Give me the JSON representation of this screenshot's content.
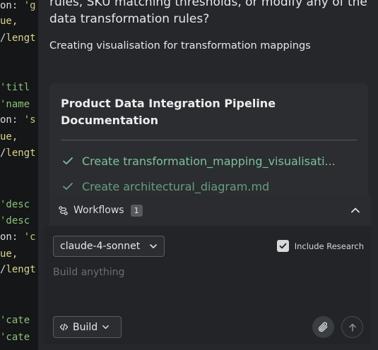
{
  "code_strip": {
    "lines": [
      {
        "a": "on: ",
        "b": "'g"
      },
      {
        "a": "ue,",
        "b": ""
      },
      {
        "a": "lengt",
        "b": ""
      },
      {
        "a": "'titl",
        "b": ""
      },
      {
        "a": "'name",
        "b": ""
      },
      {
        "a": "on: ",
        "b": "'s"
      },
      {
        "a": "ue,",
        "b": ""
      },
      {
        "a": "lengt",
        "b": ""
      },
      {
        "a": "'desc",
        "b": ""
      },
      {
        "a": "'desc",
        "b": ""
      },
      {
        "a": "on: ",
        "b": "'c"
      },
      {
        "a": "ue,",
        "b": ""
      },
      {
        "a": "lengt",
        "b": ""
      },
      {
        "a": "'cate",
        "b": ""
      },
      {
        "a": "'cate",
        "b": ""
      }
    ]
  },
  "chat": {
    "assistant_message_line1": "rules, SKU matching thresholds, or modify any of the",
    "assistant_message_line2": "data transformation rules?",
    "status": "Creating visualisation for transformation mappings"
  },
  "task_card": {
    "title": "Product Data Integration Pipeline Documentation",
    "items": [
      {
        "label": "Create transformation_mapping_visualisati..."
      },
      {
        "label": "Create architectural_diagram.md"
      }
    ]
  },
  "workflows": {
    "label": "Workflows",
    "count": "1"
  },
  "composer": {
    "model": "claude-4-sonnet",
    "include_research_label": "Include Research",
    "include_research_checked": true,
    "placeholder": "Build anything",
    "value": "",
    "mode_label": "Build"
  },
  "icons": {
    "workflow": "workflow-icon",
    "collapse": "chevron-up-icon",
    "check": "check-icon",
    "attach": "paperclip-icon",
    "send": "arrow-up-icon",
    "code": "code-icon"
  },
  "colors": {
    "accent_green": "#7cc29a",
    "panel": "#25272a",
    "background": "#17181a"
  }
}
